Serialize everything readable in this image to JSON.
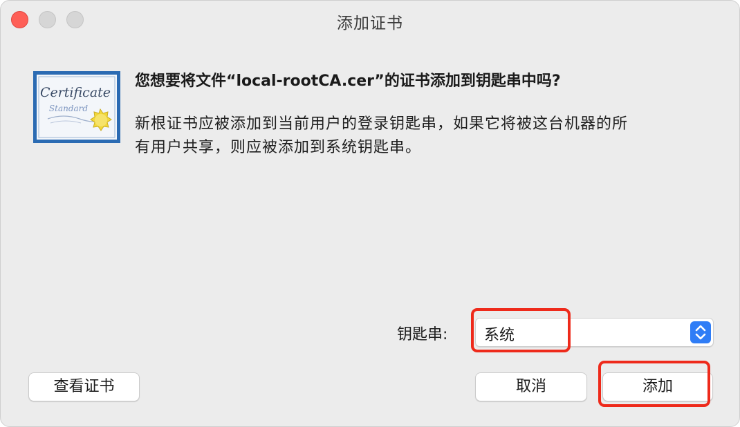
{
  "window": {
    "title": "添加证书"
  },
  "certificate_icon": {
    "name": "certificate-icon",
    "text_line1": "Certificate",
    "text_line2": "Standard",
    "frame_color": "#2b6bb3",
    "seal_color": "#f2d73a"
  },
  "message": {
    "headline": "您想要将文件“local-rootCA.cer”的证书添加到钥匙串中吗?",
    "body_line1": "新根证书应被添加到当前用户的登录钥匙串，如果它将被这台机器的所",
    "body_line2": "有用户共享，则应被添加到系统钥匙串。"
  },
  "keychain": {
    "label": "钥匙串:",
    "selected": "系统"
  },
  "buttons": {
    "view_certificate": "查看证书",
    "cancel": "取消",
    "add": "添加"
  },
  "colors": {
    "close": "#fe5f57",
    "accent": "#2f7df6",
    "highlight": "#ee2a1b"
  }
}
